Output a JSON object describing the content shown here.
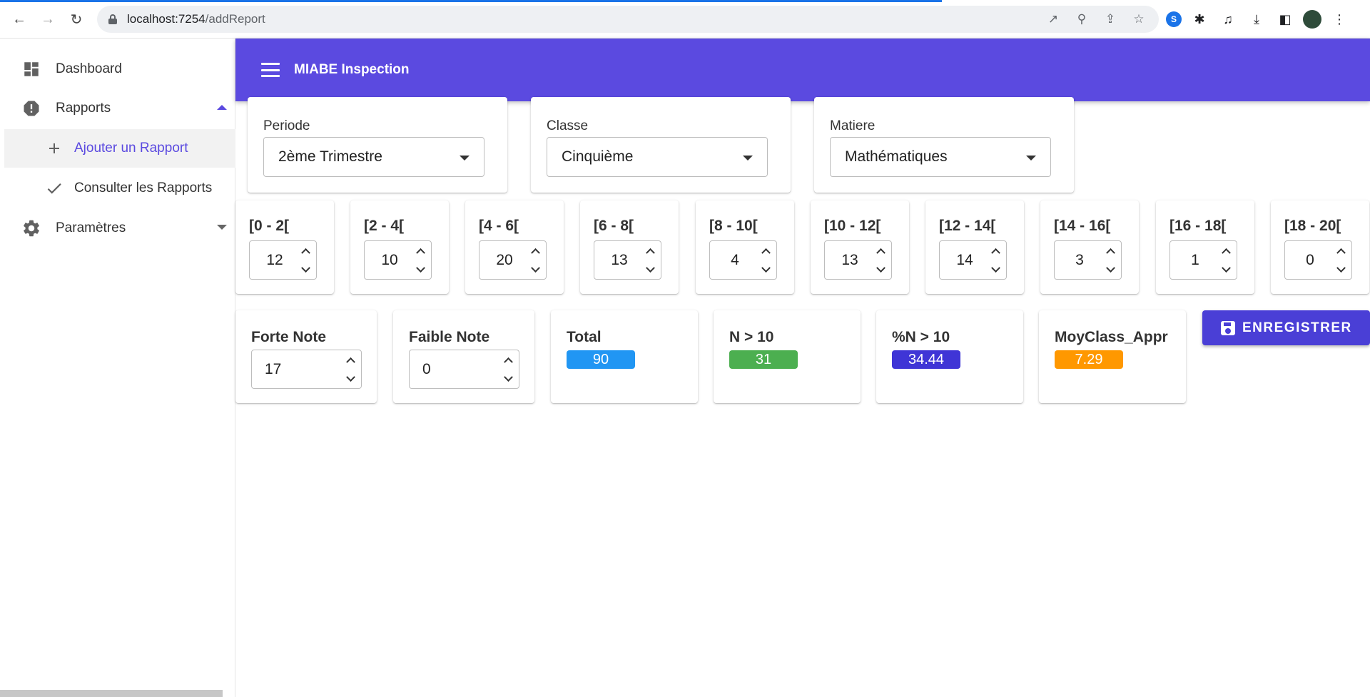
{
  "browser": {
    "url_host": "localhost:7254",
    "url_path": "/addReport",
    "back_icon": "arrow-left",
    "forward_icon": "arrow-right",
    "reload_icon": "reload"
  },
  "sidebar": {
    "items": [
      {
        "label": "Dashboard",
        "icon": "dashboard-icon"
      },
      {
        "label": "Rapports",
        "icon": "report-icon"
      },
      {
        "label": "Ajouter un Rapport",
        "icon": "plus-icon"
      },
      {
        "label": "Consulter les Rapports",
        "icon": "check-icon"
      },
      {
        "label": "Paramètres",
        "icon": "gear-icon"
      }
    ]
  },
  "appbar": {
    "title": "MIABE Inspection"
  },
  "filters": {
    "periode": {
      "label": "Periode",
      "value": "2ème Trimestre"
    },
    "classe": {
      "label": "Classe",
      "value": "Cinquième"
    },
    "matiere": {
      "label": "Matiere",
      "value": "Mathématiques"
    }
  },
  "ranges": [
    {
      "label": "[0 - 2[",
      "value": "12"
    },
    {
      "label": "[2 - 4[",
      "value": "10"
    },
    {
      "label": "[4 - 6[",
      "value": "20"
    },
    {
      "label": "[6 - 8[",
      "value": "13"
    },
    {
      "label": "[8 - 10[",
      "value": "4"
    },
    {
      "label": "[10 - 12[",
      "value": "13"
    },
    {
      "label": "[12 - 14[",
      "value": "14"
    },
    {
      "label": "[14 - 16[",
      "value": "3"
    },
    {
      "label": "[16 - 18[",
      "value": "1"
    },
    {
      "label": "[18 - 20[",
      "value": "0"
    }
  ],
  "stats": {
    "forte": {
      "label": "Forte Note",
      "value": "17"
    },
    "faible": {
      "label": "Faible Note",
      "value": "0"
    },
    "total": {
      "label": "Total",
      "value": "90",
      "color": "#2196f3"
    },
    "n10": {
      "label": "N > 10",
      "value": "31",
      "color": "#4caf50"
    },
    "pn10": {
      "label": "%N > 10",
      "value": "34.44",
      "color": "#3f35d6"
    },
    "moy": {
      "label": "MoyClass_Appr",
      "value": "7.29",
      "color": "#ff9800"
    }
  },
  "save_button": {
    "label": "ENREGISTRER"
  }
}
